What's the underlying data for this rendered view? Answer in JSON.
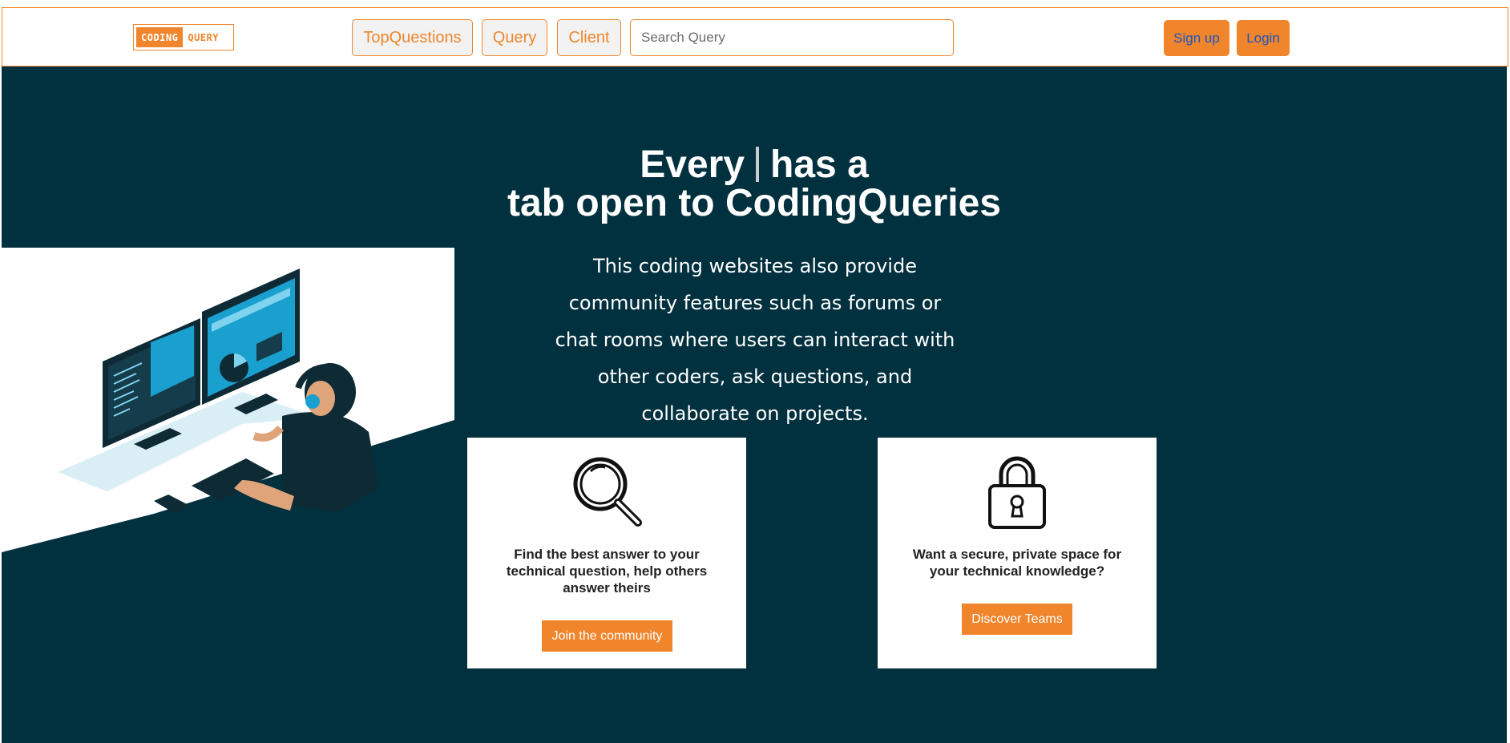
{
  "header": {
    "logo": {
      "left_text": "CODING",
      "right_text": "QUERY"
    },
    "nav": [
      {
        "label": "TopQuestions"
      },
      {
        "label": "Query"
      },
      {
        "label": "Client"
      }
    ],
    "search": {
      "placeholder": "Search Query",
      "value": ""
    },
    "signup_label": "Sign up",
    "login_label": "Login"
  },
  "hero": {
    "title_part1": "Every",
    "title_part2": "has a",
    "title_line2": "tab open to CodingQueries",
    "description": "This coding websites also provide community features such as forums or chat rooms where users can interact with other coders, ask questions, and collaborate on projects."
  },
  "cards": [
    {
      "icon": "magnifier-icon",
      "text": "Find the best answer to your technical question, help others answer theirs",
      "button_label": "Join the community"
    },
    {
      "icon": "padlock-icon",
      "text": "Want a secure, private space for your technical knowledge?",
      "button_label": "Discover Teams"
    }
  ],
  "colors": {
    "accent": "#f0852b",
    "hero_bg": "#01303f",
    "link_blue": "#1a56c4"
  }
}
